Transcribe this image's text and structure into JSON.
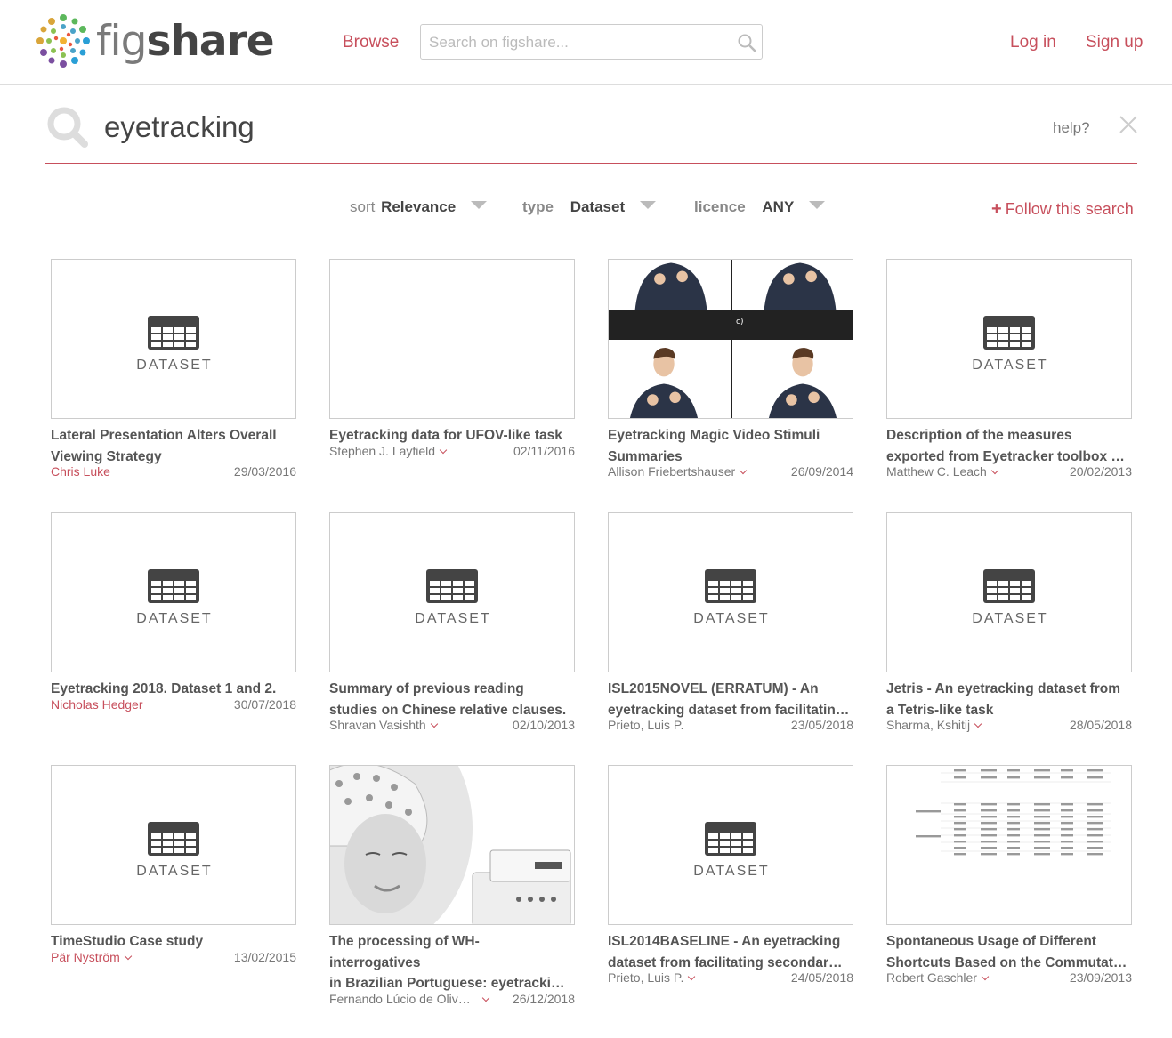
{
  "header": {
    "logo_text_a": "fig",
    "logo_text_b": "share",
    "browse": "Browse",
    "search_placeholder": "Search on figshare...",
    "login": "Log in",
    "signup": "Sign up"
  },
  "search": {
    "query": "eyetracking",
    "help": "help?"
  },
  "filters": {
    "sort_label": "sort",
    "sort_value": "Relevance",
    "type_label": "type",
    "type_value": "Dataset",
    "licence_label": "licence",
    "licence_value": "ANY",
    "follow": "Follow this search",
    "follow_plus": "+"
  },
  "colors": {
    "accent": "#c74f5c",
    "text": "#555555",
    "border": "#cccccc"
  },
  "dataset_label": "DATASET",
  "cards": [
    {
      "title1": "Lateral Presentation Alters Overall",
      "title2": "Viewing Strategy",
      "title3": "",
      "author": "Chris Luke",
      "date": "29/03/2016",
      "thumb": "dataset"
    },
    {
      "title1": "Eyetracking data for UFOV-like task",
      "title2": "",
      "title3": "",
      "author": "Stephen J. Layfield",
      "date": "02/11/2016",
      "thumb": "blank"
    },
    {
      "title1": "Eyetracking Magic Video Stimuli",
      "title2": "Summaries",
      "title3": "",
      "author": "Allison Friebertshauser",
      "date": "26/09/2014",
      "thumb": "photo-magic"
    },
    {
      "title1": "Description of the measures",
      "title2": "exported from Eyetracker toolbox …",
      "title3": "",
      "author": "Matthew C. Leach",
      "date": "20/02/2013",
      "thumb": "dataset"
    },
    {
      "title1": "Eyetracking 2018. Dataset 1 and 2.",
      "title2": "",
      "title3": "",
      "author": "Nicholas Hedger",
      "date": "30/07/2018",
      "thumb": "dataset"
    },
    {
      "title1": "Summary of previous reading",
      "title2": "studies on Chinese relative clauses.",
      "title3": "",
      "author": "Shravan Vasishth",
      "date": "02/10/2013",
      "thumb": "dataset"
    },
    {
      "title1": "ISL2015NOVEL (ERRATUM) - An",
      "title2": "eyetracking dataset from facilitatin…",
      "title3": "",
      "author": "Prieto, Luis P.",
      "date": "23/05/2018",
      "thumb": "dataset"
    },
    {
      "title1": "Jetris - An eyetracking dataset from",
      "title2": "a Tetris-like task",
      "title3": "",
      "author": "Sharma, Kshitij",
      "date": "28/05/2018",
      "thumb": "dataset"
    },
    {
      "title1": "TimeStudio Case study",
      "title2": "",
      "title3": "",
      "author": "Pär Nyström",
      "date": "13/02/2015",
      "thumb": "dataset"
    },
    {
      "title1": "The processing of WH-",
      "title2": "interrogatives",
      "title3": "in Brazilian Portuguese: eyetracki…",
      "author": "Fernando Lúcio de Oliv…",
      "date": "26/12/2018",
      "thumb": "photo-eeg"
    },
    {
      "title1": "ISL2014BASELINE - An eyetracking",
      "title2": "dataset from facilitating secondar…",
      "title3": "",
      "author": "Prieto, Luis P.",
      "date": "24/05/2018",
      "thumb": "dataset"
    },
    {
      "title1": "Spontaneous Usage of Different",
      "title2": "Shortcuts Based on the Commutat…",
      "title3": "",
      "author": "Robert Gaschler",
      "date": "23/09/2013",
      "thumb": "table"
    }
  ]
}
